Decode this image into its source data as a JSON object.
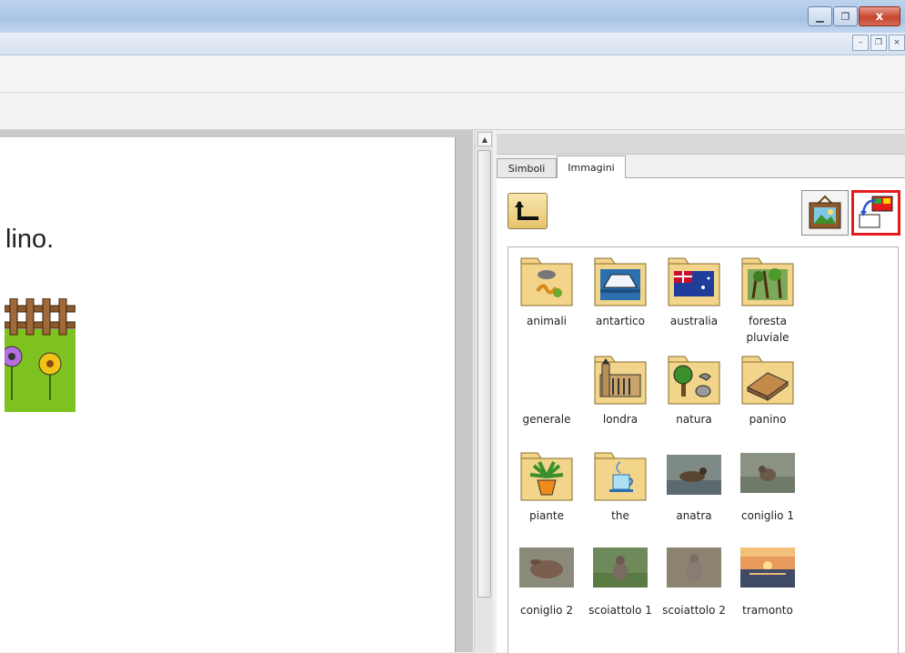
{
  "window": {
    "buttons": [
      "minimize-icon",
      "restore-icon",
      "close-icon"
    ],
    "close_label": "x"
  },
  "document": {
    "text": "lino."
  },
  "panel": {
    "tabs": [
      {
        "label": "Simboli",
        "active": false
      },
      {
        "label": "Immagini",
        "active": true
      }
    ],
    "items": [
      {
        "label": "animali",
        "kind": "folder"
      },
      {
        "label": "antartico",
        "kind": "folder"
      },
      {
        "label": "australia",
        "kind": "folder"
      },
      {
        "label": "foresta pluviale",
        "kind": "folder"
      },
      {
        "label": "generale",
        "kind": "folder-empty"
      },
      {
        "label": "londra",
        "kind": "folder"
      },
      {
        "label": "natura",
        "kind": "folder"
      },
      {
        "label": "panino",
        "kind": "folder"
      },
      {
        "label": "piante",
        "kind": "folder"
      },
      {
        "label": "the",
        "kind": "folder"
      },
      {
        "label": "anatra",
        "kind": "photo"
      },
      {
        "label": "coniglio 1",
        "kind": "photo"
      },
      {
        "label": "coniglio 2",
        "kind": "photo"
      },
      {
        "label": "scoiattolo 1",
        "kind": "photo"
      },
      {
        "label": "scoiattolo 2",
        "kind": "photo"
      },
      {
        "label": "tramonto",
        "kind": "photo"
      }
    ]
  },
  "colors": {
    "folder": "#f2d58a",
    "folder_border": "#8a6d2c",
    "accent_red": "#e41b1b"
  }
}
